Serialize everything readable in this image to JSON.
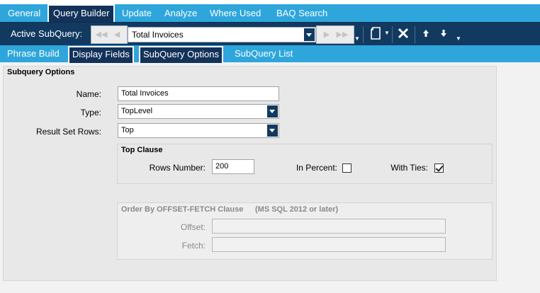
{
  "main_tabs": [
    {
      "label": "General"
    },
    {
      "label": "Query Builder",
      "active": true
    },
    {
      "label": "Update"
    },
    {
      "label": "Analyze"
    },
    {
      "label": "Where Used"
    },
    {
      "label": "BAQ Search"
    }
  ],
  "toolbar": {
    "active_subquery_label": "Active SubQuery:",
    "subquery_value": "Total Invoices",
    "icons": [
      "first-icon",
      "previous-icon",
      "next-icon",
      "last-icon",
      "new-document-icon",
      "delete-icon",
      "move-up-icon",
      "move-down-icon"
    ]
  },
  "sub_tabs": [
    {
      "label": "Phrase Build"
    },
    {
      "label": "Display Fields"
    },
    {
      "label": "SubQuery Options",
      "active": true
    },
    {
      "label": "SubQuery List"
    }
  ],
  "subquery_options": {
    "title": "Subquery Options",
    "name_label": "Name:",
    "name_value": "Total Invoices",
    "type_label": "Type:",
    "type_value": "TopLevel",
    "result_rows_label": "Result Set Rows:",
    "result_rows_value": "Top"
  },
  "top_clause": {
    "title": "Top Clause",
    "rows_number_label": "Rows Number:",
    "rows_number_value": "200",
    "in_percent_label": "In Percent:",
    "in_percent": false,
    "with_ties_label": "With Ties:",
    "with_ties": true
  },
  "offset_fetch": {
    "title": "Order By OFFSET-FETCH Clause",
    "note": "(MS SQL 2012 or later)",
    "offset_label": "Offset:",
    "offset_value": "",
    "fetch_label": "Fetch:",
    "fetch_value": ""
  },
  "colors": {
    "tab_bar": "#2ea6dc",
    "toolbar": "#123a60",
    "active_tab": "#12325a"
  }
}
